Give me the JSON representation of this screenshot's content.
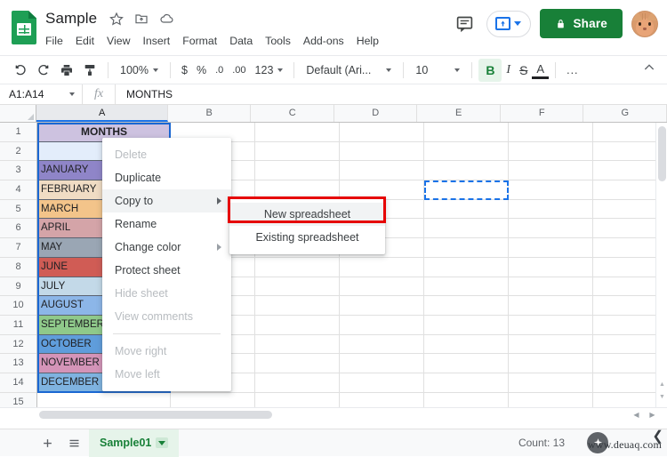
{
  "header": {
    "doc_title": "Sample",
    "title_icons": [
      "star-icon",
      "move-to-folder-icon",
      "cloud-saved-icon"
    ],
    "menus": [
      "File",
      "Edit",
      "View",
      "Insert",
      "Format",
      "Data",
      "Tools",
      "Add-ons",
      "Help"
    ],
    "comment_icon": "comment-icon",
    "present_label": "",
    "share_label": "Share",
    "share_color": "#188038",
    "accent_color": "#1a73e8"
  },
  "toolbar": {
    "undo": "undo-icon",
    "redo": "redo-icon",
    "print": "print-icon",
    "paint": "paint-format-icon",
    "zoom": "100%",
    "currency": "$",
    "percent": "%",
    "decrease_decimal": ".0",
    "increase_decimal": ".00",
    "number_format": "123",
    "font": "Default (Ari...",
    "font_size": "10",
    "bold": "B",
    "italic": "I",
    "strikethrough": "S",
    "text_color": "A",
    "more": "...",
    "collapse": "chevron-up-icon"
  },
  "formula_bar": {
    "name_box": "A1:A14",
    "fx": "fx",
    "formula_value": "MONTHS"
  },
  "grid": {
    "columns": [
      "A",
      "B",
      "C",
      "D",
      "E",
      "F",
      "G"
    ],
    "selected_column": "A",
    "rows": [
      "1",
      "2",
      "3",
      "4",
      "5",
      "6",
      "7",
      "8",
      "9",
      "10",
      "11",
      "12",
      "13",
      "14",
      "15"
    ],
    "cells_col_a": [
      {
        "row": "1",
        "value": "MONTHS",
        "bg": "#cdc2e0",
        "header": true
      },
      {
        "row": "2",
        "value": "",
        "bg": "#e3edfb",
        "header": false
      },
      {
        "row": "3",
        "value": "JANUARY",
        "bg": "#8f85c8",
        "header": false
      },
      {
        "row": "4",
        "value": "FEBRUARY",
        "bg": "#f0dcc4",
        "header": false
      },
      {
        "row": "5",
        "value": "MARCH",
        "bg": "#f3c48a",
        "header": false
      },
      {
        "row": "6",
        "value": "APRIL",
        "bg": "#d4a4a8",
        "header": false
      },
      {
        "row": "7",
        "value": "MAY",
        "bg": "#9aa6b4",
        "header": false
      },
      {
        "row": "8",
        "value": "JUNE",
        "bg": "#d05c55",
        "header": false
      },
      {
        "row": "9",
        "value": "JULY",
        "bg": "#c3d9e8",
        "header": false
      },
      {
        "row": "10",
        "value": "AUGUST",
        "bg": "#8cb6e8",
        "header": false
      },
      {
        "row": "11",
        "value": "SEPTEMBER",
        "bg": "#8fc98a",
        "header": false
      },
      {
        "row": "12",
        "value": "OCTOBER",
        "bg": "#5f9ddb",
        "header": false
      },
      {
        "row": "13",
        "value": "NOVEMBER",
        "bg": "#d494b8",
        "header": false
      },
      {
        "row": "14",
        "value": "DECEMBER",
        "bg": "#7fb3e0",
        "header": false
      },
      {
        "row": "15",
        "value": "",
        "bg": "#ffffff",
        "header": false
      }
    ],
    "copied_range_cell": "E4",
    "marching_ants_color": "#1a73e8"
  },
  "context_menu": {
    "items": [
      {
        "label": "Delete",
        "disabled": true,
        "submenu": false,
        "active": false
      },
      {
        "label": "Duplicate",
        "disabled": false,
        "submenu": false,
        "active": false
      },
      {
        "label": "Copy to",
        "disabled": false,
        "submenu": true,
        "active": true
      },
      {
        "label": "Rename",
        "disabled": false,
        "submenu": false,
        "active": false
      },
      {
        "label": "Change color",
        "disabled": false,
        "submenu": true,
        "active": false
      },
      {
        "label": "Protect sheet",
        "disabled": false,
        "submenu": false,
        "active": false
      },
      {
        "label": "Hide sheet",
        "disabled": true,
        "submenu": false,
        "active": false
      },
      {
        "label": "View comments",
        "disabled": true,
        "submenu": false,
        "active": false
      },
      {
        "separator": true
      },
      {
        "label": "Move right",
        "disabled": true,
        "submenu": false,
        "active": false
      },
      {
        "label": "Move left",
        "disabled": true,
        "submenu": false,
        "active": false
      }
    ]
  },
  "submenu": {
    "items": [
      {
        "label": "New spreadsheet",
        "highlighted": true
      },
      {
        "label": "Existing spreadsheet",
        "highlighted": false
      }
    ],
    "highlight_color": "#e60000"
  },
  "sheet_bar": {
    "add_sheet": "plus-icon",
    "all_sheets": "list-icon",
    "tab_name": "Sample01",
    "tab_caret": "chevron-down-icon",
    "count_label": "Count: 13",
    "explore": "explore-icon"
  },
  "watermark": {
    "text": "www.deuaq.com"
  }
}
